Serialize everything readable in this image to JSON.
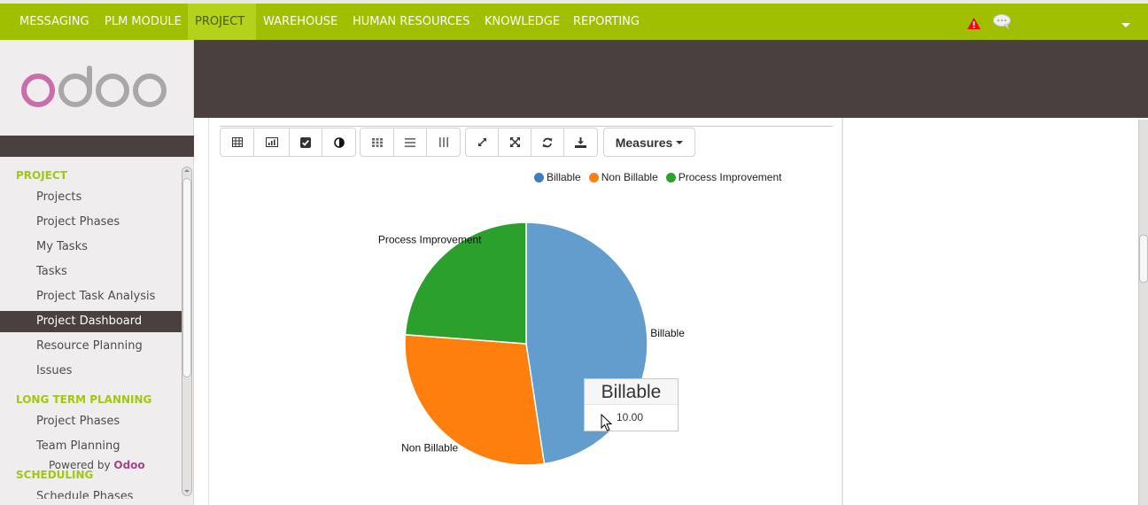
{
  "menubar": {
    "items": [
      {
        "label": "MESSAGING",
        "active": false
      },
      {
        "label": "PLM MODULE",
        "active": false
      },
      {
        "label": "PROJECT",
        "active": true
      },
      {
        "label": "WAREHOUSE",
        "active": false
      },
      {
        "label": "HUMAN RESOURCES",
        "active": false
      },
      {
        "label": "KNOWLEDGE",
        "active": false
      },
      {
        "label": "REPORTING",
        "active": false
      }
    ],
    "icons": [
      "alert-icon",
      "chat-icon",
      "user-menu-caret"
    ],
    "brand_color": "#a0bf00"
  },
  "sidebar": {
    "logo_text": "odoo",
    "sections": [
      {
        "header": "PROJECT",
        "items": [
          "Projects",
          "Project Phases",
          "My Tasks",
          "Tasks",
          "Project Task Analysis",
          "Project Dashboard",
          "Resource Planning",
          "Issues"
        ]
      },
      {
        "header": "LONG TERM PLANNING",
        "items": [
          "Project Phases",
          "Team Planning"
        ]
      },
      {
        "header": "SCHEDULING",
        "items": [
          "Schedule Phases"
        ]
      }
    ],
    "active_item": "Project Dashboard",
    "powered_by": "Powered by",
    "powered_brand": "Odoo"
  },
  "toolbar": {
    "view_buttons": [
      "table-icon",
      "bar-chart-icon",
      "checkbox-icon",
      "pie-icon"
    ],
    "layout_buttons": [
      "grid-icon",
      "rows-icon",
      "columns-icon"
    ],
    "action_buttons": [
      "expand-icon",
      "fullscreen-icon",
      "refresh-icon",
      "download-icon"
    ],
    "measures_label": "Measures"
  },
  "tooltip": {
    "title": "Billable",
    "value": "10.00"
  },
  "chart_data": {
    "type": "pie",
    "title": "",
    "categories": [
      "Billable",
      "Non Billable",
      "Process Improvement"
    ],
    "values": [
      10,
      6,
      5
    ],
    "colors": [
      "#629dce",
      "#ff7f0e",
      "#2ca02c"
    ],
    "legend_colors": [
      "#3a7fc0",
      "#ff7f0e",
      "#2ca02c"
    ],
    "legend": [
      "Billable",
      "Non Billable",
      "Process Improvement"
    ],
    "legend_position": "top-right",
    "start_angle": "top, clockwise"
  }
}
